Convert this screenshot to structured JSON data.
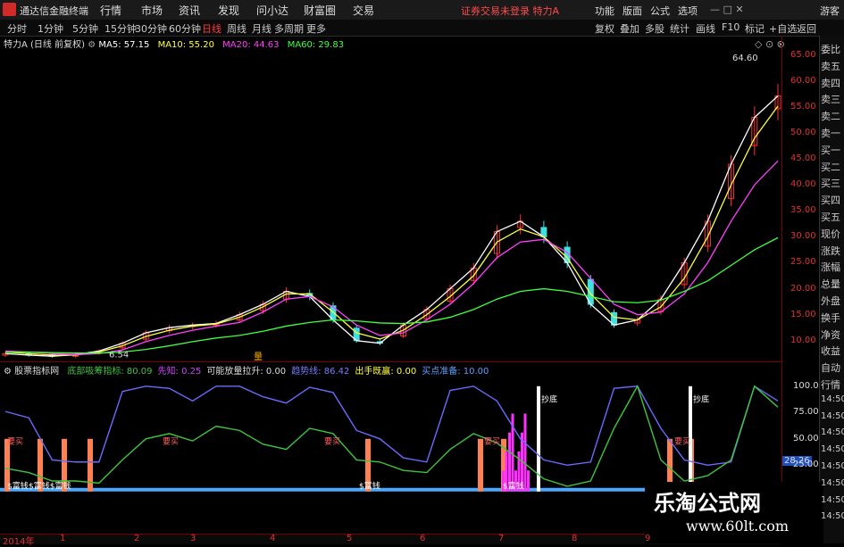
{
  "app": {
    "title": "通达信金融终端"
  },
  "menu": [
    "行情",
    "市场",
    "资讯",
    "发现",
    "问小达",
    "财富圈",
    "交易"
  ],
  "notice": "证券交易未登录",
  "stock_name": "特力A",
  "right_menu": [
    "功能",
    "版面",
    "公式",
    "选项"
  ],
  "guest": "游客",
  "periods": [
    "分时",
    "1分钟",
    "5分钟",
    "15分钟",
    "30分钟",
    "60分钟",
    "日线",
    "周线",
    "月线",
    "多周期",
    "更多"
  ],
  "active_period": "日线",
  "tools": [
    "复权",
    "叠加",
    "多股",
    "统计",
    "画线",
    "F10",
    "标记",
    "+自选",
    "返回"
  ],
  "ma": {
    "header": "特力A (日线 前复权)",
    "ma5": "MA5: 57.15",
    "ma10": "MA10: 55.20",
    "ma20": "MA20: 44.63",
    "ma60": "MA60: 29.83",
    "max_label": "64.60",
    "min_label": "6.54",
    "marker": "量"
  },
  "price_axis": [
    "65.00",
    "60.00",
    "55.00",
    "50.00",
    "45.00",
    "40.00",
    "35.00",
    "30.00",
    "25.00",
    "20.00",
    "15.00",
    "10.00"
  ],
  "indicator": {
    "name": "股票指标网",
    "items": [
      {
        "label": "底部吸筹指标: ",
        "value": "80.09",
        "color": "#3ec43e"
      },
      {
        "label": "先知: ",
        "value": "0.25",
        "color": "#d040ff"
      },
      {
        "label": "可能放量拉升: ",
        "value": "0.00",
        "color": "#dddddd"
      },
      {
        "label": "趋势线: ",
        "value": "86.42",
        "color": "#7a7aff"
      },
      {
        "label": "出手既赢: ",
        "value": "0.00",
        "color": "#ffff40"
      },
      {
        "label": "买点准备: ",
        "value": "10.00",
        "color": "#5aa0ff"
      }
    ],
    "axis": [
      "100.0",
      "75.00",
      "50.00",
      "28.26",
      "25.00"
    ],
    "signals": {
      "buy": "要买",
      "bottom": "抄底",
      "cash": "$富钱",
      "cash2": "$富钱$富钱"
    }
  },
  "sidebar": [
    "委比",
    "卖五",
    "卖四",
    "卖三",
    "卖二",
    "卖一",
    "买一",
    "买二",
    "买三",
    "买四",
    "买五",
    "现价",
    "涨跌",
    "涨幅",
    "总量",
    "外盘",
    "换手",
    "净资",
    "收益",
    "自动",
    "行情",
    "14:50",
    "14:50",
    "14:50",
    "14:50",
    "14:50",
    "14:50",
    "14:50",
    "14:50"
  ],
  "dates": [
    "2014年",
    "1",
    "2",
    "3",
    "4",
    "5",
    "6",
    "7",
    "8",
    "9"
  ],
  "watermark": {
    "line1": "乐淘公式网",
    "line2": "www.60lt.com"
  },
  "chart_data": {
    "type": "line",
    "title": "特力A (日线 前复权)",
    "ylim": [
      6,
      66
    ],
    "series": [
      {
        "name": "MA5",
        "values": [
          7.5,
          7.2,
          7,
          7.3,
          8,
          9.5,
          11.5,
          12.5,
          13,
          13.3,
          15,
          17,
          19.5,
          18.5,
          14,
          10,
          9.5,
          13,
          16,
          20,
          24,
          31,
          33,
          30,
          25,
          17,
          13,
          14,
          18,
          25,
          33,
          44,
          53,
          57.15
        ]
      },
      {
        "name": "MA10",
        "values": [
          7.8,
          7.5,
          7.2,
          7.2,
          7.8,
          9,
          10.8,
          12,
          12.8,
          13.2,
          14.5,
          16.5,
          19,
          19,
          15.5,
          11.5,
          10.3,
          12,
          15,
          18.5,
          22.5,
          29,
          31.5,
          30,
          26,
          19,
          14.5,
          14,
          16.5,
          22,
          30,
          40,
          49,
          55.2
        ]
      },
      {
        "name": "MA20",
        "values": [
          8,
          7.8,
          7.5,
          7.3,
          7.5,
          8.2,
          9.8,
          11,
          12,
          12.8,
          13.5,
          15.5,
          18,
          18.5,
          16.5,
          13,
          11,
          11.5,
          14,
          17,
          21,
          26,
          29,
          29.5,
          27,
          22,
          17,
          15,
          15.5,
          19,
          25,
          33,
          40,
          44.63
        ]
      },
      {
        "name": "MA60",
        "values": [
          7.8,
          7.8,
          7.7,
          7.6,
          7.6,
          7.8,
          8.3,
          9,
          9.8,
          10.5,
          11,
          11.8,
          12.8,
          13.5,
          14,
          13.8,
          13.4,
          13.3,
          13.6,
          14.5,
          16,
          18,
          19.5,
          20,
          19.5,
          18.5,
          17.5,
          17.3,
          17.8,
          19.5,
          21.5,
          24.5,
          27.5,
          29.83
        ]
      }
    ],
    "indicator_series": [
      {
        "name": "趋势线",
        "values": [
          76,
          70,
          30,
          28,
          28,
          95,
          100,
          98,
          86,
          100,
          100,
          90,
          84,
          99,
          94,
          58,
          50,
          32,
          28,
          96,
          100,
          86,
          50,
          30,
          25,
          28,
          98,
          100,
          60,
          30,
          25,
          28,
          100,
          86
        ]
      },
      {
        "name": "底部吸筹指标",
        "values": [
          22,
          18,
          10,
          10,
          8,
          30,
          50,
          55,
          48,
          62,
          58,
          45,
          40,
          60,
          55,
          30,
          28,
          20,
          18,
          40,
          55,
          46,
          30,
          12,
          5,
          10,
          60,
          100,
          30,
          10,
          15,
          30,
          100,
          80.09
        ]
      }
    ]
  }
}
